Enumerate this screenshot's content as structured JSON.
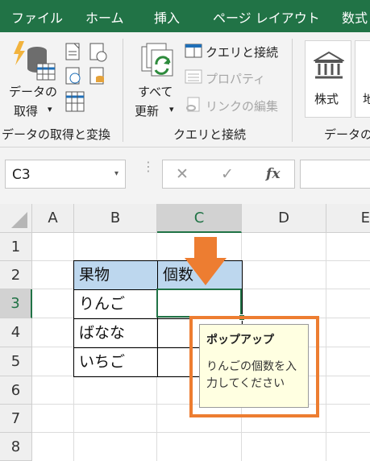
{
  "tabs": [
    "ファイル",
    "ホーム",
    "挿入",
    "ページ レイアウト",
    "数式"
  ],
  "ribbon": {
    "get_data": {
      "line1": "データの",
      "line2": "取得",
      "dropdown": "▾"
    },
    "refresh": {
      "line1": "すべて",
      "line2": "更新",
      "dropdown": "▾"
    },
    "queries_connections": "クエリと接続",
    "properties": "プロパティ",
    "edit_links": "リンクの編集",
    "stocks": "株式",
    "geo_partial": "地",
    "groups": {
      "get_transform": "データの取得と変換",
      "queries": "クエリと接続",
      "data_types_partial": "データの"
    }
  },
  "formula_bar": {
    "name_box": "C3",
    "name_box_arrow": "▾",
    "separator": "⋮",
    "cancel": "✕",
    "enter": "✓",
    "fx": "fx",
    "formula": ""
  },
  "columns": [
    "A",
    "B",
    "C",
    "D",
    "E"
  ],
  "rows": [
    "1",
    "2",
    "3",
    "4",
    "5",
    "6",
    "7",
    "8"
  ],
  "table": {
    "header": [
      "果物",
      "個数"
    ],
    "rows": [
      [
        "りんご",
        ""
      ],
      [
        "ばなな",
        ""
      ],
      [
        "いちご",
        ""
      ]
    ]
  },
  "popup": {
    "title": "ポップアップ",
    "message": "りんごの個数を入力してください"
  },
  "colors": {
    "excel_green": "#217346",
    "accent_orange": "#ed7d31",
    "table_header": "#bdd7ee",
    "popup_bg": "#ffffe1"
  }
}
